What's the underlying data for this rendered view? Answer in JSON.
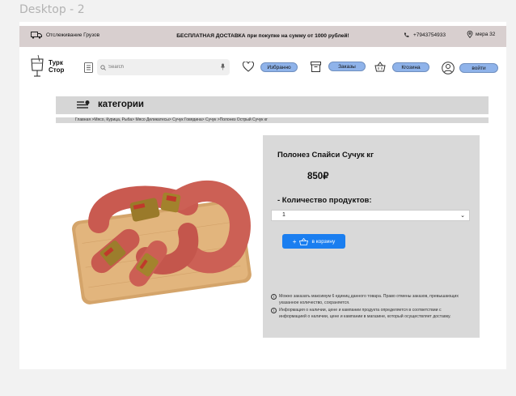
{
  "frame_label": "Desktop - 2",
  "topbar": {
    "tracking": "Отслеживание Грузов",
    "shipping": "БЕСПЛАТНАЯ ДОСТАВКА при покупке на сумму от 1000 рублей!",
    "phone": "+7943754933",
    "location": "мера 32"
  },
  "header": {
    "logo_line1": "Турк",
    "logo_line2": "Стор",
    "search_placeholder": "Search",
    "favorites_label": "Избранно",
    "orders_label": "Заказы",
    "cart_label": "Кrозина",
    "login_label": "войти"
  },
  "category": {
    "title": "категории",
    "breadcrumb": "Главная >Мясо, Курица, Рыба> Мясо Деликатесы> Сучук Говядина> Сучук >Полонез Острый Сучук кг"
  },
  "product": {
    "name": "Полонез Спайси Сучук кг",
    "price": "850₽",
    "qty_label": "- Количество продуктов:",
    "qty_value": "1",
    "add_to_cart": "в корзину",
    "note1": "Можно заказать максимум 6 единиц данного товара. Право отмены заказов, превышающих указанное количество, сохраняется.",
    "note2": "Информация о наличии, цене и кампании продукта определяется в соответствии с информацией о наличии, цене и кампании в магазине, который осуществляет доставку."
  },
  "colors": {
    "topbar_bg": "#d8cfcf",
    "pill_bg": "#8fb3ea",
    "cart_button": "#1a7ef0",
    "panel_bg": "#d9d9d9"
  }
}
